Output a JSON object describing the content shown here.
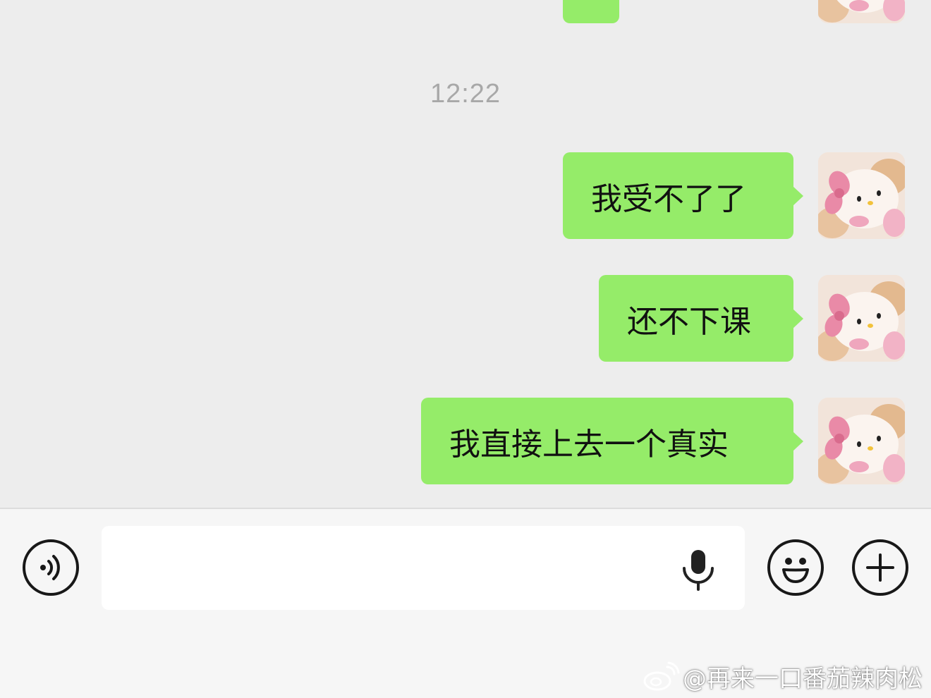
{
  "chat": {
    "timestamp": "12:22",
    "messages": [
      {
        "text": "",
        "side": "right"
      },
      {
        "text": "我受不了了",
        "side": "right"
      },
      {
        "text": "还不下课",
        "side": "right"
      },
      {
        "text": "我直接上去一个真实",
        "side": "right"
      }
    ]
  },
  "input_bar": {
    "input_value": "",
    "icons": [
      "voice-icon",
      "mic-icon",
      "emoji-icon",
      "plus-icon"
    ]
  },
  "watermark": {
    "text": "@再来一口番茄辣肉松",
    "icon": "weibo-icon"
  },
  "colors": {
    "chat_background": "#ededed",
    "bubble_green": "#95ec69",
    "bottom_bar": "#f6f6f6",
    "timestamp_gray": "#a8a8a8"
  }
}
